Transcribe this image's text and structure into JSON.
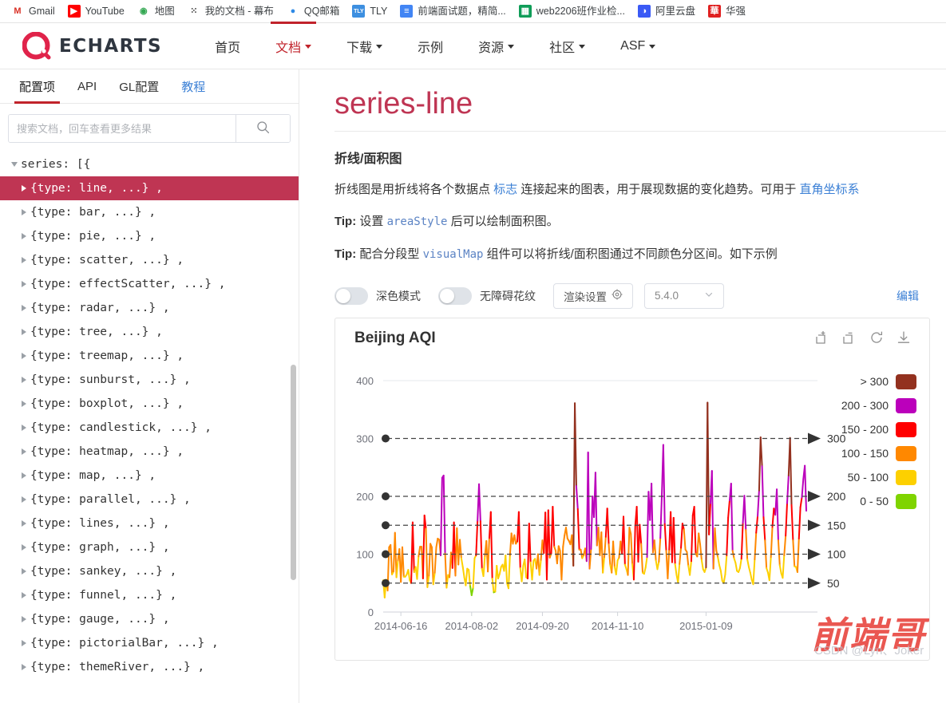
{
  "bookmarks": [
    {
      "label": "Gmail",
      "icon": "gmail-icon",
      "glyph": "M",
      "bg": "#ffffff",
      "fg": "#d93025"
    },
    {
      "label": "YouTube",
      "icon": "youtube-icon",
      "glyph": "▶",
      "bg": "#ff0000",
      "fg": "#ffffff"
    },
    {
      "label": "地图",
      "icon": "google-maps-icon",
      "glyph": "◉",
      "bg": "#ffffff",
      "fg": "#34a853"
    },
    {
      "label": "我的文档 - 幕布",
      "icon": "mubu-icon",
      "glyph": "⁙",
      "bg": "#ffffff",
      "fg": "#2b2b2b"
    },
    {
      "label": "QQ邮箱",
      "icon": "qq-mail-icon",
      "glyph": "●",
      "bg": "#ffffff",
      "fg": "#2e8ae6"
    },
    {
      "label": "TLY",
      "icon": "tly-icon",
      "glyph": "TLY",
      "bg": "#3d8fe0",
      "fg": "#ffffff"
    },
    {
      "label": "前端面试题，精简...",
      "icon": "google-docs-icon",
      "glyph": "≡",
      "bg": "#4285f4",
      "fg": "#ffffff"
    },
    {
      "label": "web2206班作业检...",
      "icon": "google-sheets-icon",
      "glyph": "▦",
      "bg": "#0f9d58",
      "fg": "#ffffff"
    },
    {
      "label": "阿里云盘",
      "icon": "aliyun-drive-icon",
      "glyph": "◑",
      "bg": "#3a5af5",
      "fg": "#ffffff"
    },
    {
      "label": "华强",
      "icon": "huaqiang-icon",
      "glyph": "華",
      "bg": "#e02020",
      "fg": "#ffffff"
    }
  ],
  "header": {
    "brand": "ECHARTS",
    "nav": [
      {
        "label": "首页",
        "caret": false,
        "active": false
      },
      {
        "label": "文档",
        "caret": true,
        "active": true
      },
      {
        "label": "下载",
        "caret": true,
        "active": false
      },
      {
        "label": "示例",
        "caret": false,
        "active": false
      },
      {
        "label": "资源",
        "caret": true,
        "active": false
      },
      {
        "label": "社区",
        "caret": true,
        "active": false
      },
      {
        "label": "ASF",
        "caret": true,
        "active": false
      }
    ]
  },
  "sidebar": {
    "tabs": [
      {
        "label": "配置项",
        "active": true,
        "link": false
      },
      {
        "label": "API",
        "active": false,
        "link": false
      },
      {
        "label": "GL配置",
        "active": false,
        "link": false
      },
      {
        "label": "教程",
        "active": false,
        "link": true
      }
    ],
    "search": {
      "placeholder": "搜索文档，回车查看更多结果",
      "value": "",
      "icon": "search-icon"
    },
    "tree_root": "series: [{",
    "tree_items": [
      {
        "label": "{type: line, ...} ,",
        "selected": true
      },
      {
        "label": "{type: bar, ...} ,",
        "selected": false
      },
      {
        "label": "{type: pie, ...} ,",
        "selected": false
      },
      {
        "label": "{type: scatter, ...} ,",
        "selected": false
      },
      {
        "label": "{type: effectScatter, ...} ,",
        "selected": false
      },
      {
        "label": "{type: radar, ...} ,",
        "selected": false
      },
      {
        "label": "{type: tree, ...} ,",
        "selected": false
      },
      {
        "label": "{type: treemap, ...} ,",
        "selected": false
      },
      {
        "label": "{type: sunburst, ...} ,",
        "selected": false
      },
      {
        "label": "{type: boxplot, ...} ,",
        "selected": false
      },
      {
        "label": "{type: candlestick, ...} ,",
        "selected": false
      },
      {
        "label": "{type: heatmap, ...} ,",
        "selected": false
      },
      {
        "label": "{type: map, ...} ,",
        "selected": false
      },
      {
        "label": "{type: parallel, ...} ,",
        "selected": false
      },
      {
        "label": "{type: lines, ...} ,",
        "selected": false
      },
      {
        "label": "{type: graph, ...} ,",
        "selected": false
      },
      {
        "label": "{type: sankey, ...} ,",
        "selected": false
      },
      {
        "label": "{type: funnel, ...} ,",
        "selected": false
      },
      {
        "label": "{type: gauge, ...} ,",
        "selected": false
      },
      {
        "label": "{type: pictorialBar, ...} ,",
        "selected": false
      },
      {
        "label": "{type: themeRiver, ...} ,",
        "selected": false
      }
    ]
  },
  "main": {
    "title": "series-line",
    "subheading": "折线/面积图",
    "para1_a": "折线图是用折线将各个数据点 ",
    "para1_link1": "标志",
    "para1_b": " 连接起来的图表，用于展现数据的变化趋势。可用于 ",
    "para1_link2": "直角坐标系",
    "tip_label": "Tip:",
    "tip1_a": " 设置 ",
    "tip1_code": "areaStyle",
    "tip1_b": " 后可以绘制面积图。",
    "tip2_a": " 配合分段型 ",
    "tip2_code": "visualMap",
    "tip2_b": " 组件可以将折线/面积图通过不同颜色分区间。如下示例"
  },
  "demo_toolbar": {
    "dark_mode_label": "深色模式",
    "dark_mode_on": false,
    "accessible_label": "无障碍花纹",
    "accessible_on": false,
    "render_settings_label": "渲染设置",
    "render_settings_icon": "gear-icon",
    "version_value": "5.4.0",
    "version_icon": "chevron-down-icon",
    "edit_label": "编辑"
  },
  "chart_toolbox": [
    {
      "name": "data-zoom-icon",
      "title": "区域缩放"
    },
    {
      "name": "data-zoom-reset-icon",
      "title": "区域缩放还原"
    },
    {
      "name": "restore-icon",
      "title": "还原"
    },
    {
      "name": "save-image-icon",
      "title": "保存为图片"
    }
  ],
  "watermark": {
    "cn": "前端哥",
    "en": "CSDN @Lyn、Joker"
  },
  "chart_data": {
    "type": "line",
    "title": "Beijing AQI",
    "xlabel": "",
    "ylabel": "",
    "ylim": [
      0,
      400
    ],
    "yticks": [
      0,
      100,
      200,
      300,
      400
    ],
    "xtick_labels": [
      "2014-06-16",
      "2014-08-02",
      "2014-09-20",
      "2014-11-10",
      "2015-01-09"
    ],
    "grid": false,
    "legend_position": "right",
    "visual_map": {
      "type": "piecewise",
      "pieces": [
        {
          "label": "> 300",
          "color": "#93311f",
          "min": 300
        },
        {
          "label": "200 - 300",
          "color": "#bb00bb",
          "min": 200,
          "max": 300
        },
        {
          "label": "150 - 200",
          "color": "#ff0000",
          "min": 150,
          "max": 200
        },
        {
          "label": "100 - 150",
          "color": "#ff8800",
          "min": 100,
          "max": 150
        },
        {
          "label": "50 - 100",
          "color": "#fdd000",
          "min": 50,
          "max": 100
        },
        {
          "label": "0 - 50",
          "color": "#7fd400",
          "min": 0,
          "max": 50
        }
      ]
    },
    "mark_lines": [
      {
        "label": "300",
        "value": 300
      },
      {
        "label": "200",
        "value": 200
      },
      {
        "label": "150",
        "value": 150
      },
      {
        "label": "100",
        "value": 100
      },
      {
        "label": "50",
        "value": 50
      }
    ],
    "series": [
      {
        "name": "Beijing AQI",
        "values": [
          55,
          25,
          56,
          37,
          112,
          116,
          65,
          70,
          137,
          60,
          89,
          109,
          52,
          112,
          61,
          61,
          65,
          73,
          55,
          50,
          155,
          69,
          78,
          57,
          96,
          113,
          113,
          58,
          167,
          144,
          43,
          63,
          118,
          112,
          48,
          68,
          112,
          127,
          125,
          98,
          232,
          236,
          101,
          42,
          64,
          60,
          103,
          76,
          155,
          63,
          145,
          82,
          125,
          93,
          78,
          60,
          46,
          75,
          73,
          45,
          29,
          42,
          93,
          98,
          158,
          221,
          157,
          75,
          62,
          97,
          123,
          70,
          128,
          173,
          58,
          34,
          35,
          80,
          58,
          66,
          78,
          82,
          71,
          98,
          50,
          41,
          98,
          136,
          118,
          133,
          118,
          122,
          173,
          76,
          53,
          80,
          91,
          60,
          58,
          153,
          86,
          56,
          89,
          92,
          75,
          100,
          64,
          90,
          124,
          102,
          172,
          56,
          176,
          94,
          101,
          182,
          113,
          106,
          84,
          114,
          106,
          56,
          113,
          132,
          146,
          127,
          123,
          117,
          133,
          80,
          361,
          218,
          178,
          108,
          108,
          93,
          98,
          110,
          88,
          276,
          75,
          109,
          200,
          164,
          241,
          115,
          146,
          98,
          138,
          68,
          95,
          130,
          179,
          117,
          81,
          68,
          122,
          78,
          65,
          89,
          94,
          122,
          101,
          165,
          82,
          74,
          64,
          146,
          135,
          83,
          56,
          150,
          182,
          87,
          151,
          118,
          68,
          66,
          77,
          95,
          208,
          159,
          222,
          103,
          124,
          89,
          74,
          87,
          128,
          201,
          289,
          152,
          106,
          58,
          108,
          173,
          86,
          163,
          83,
          64,
          51,
          83,
          111,
          153,
          143,
          108,
          104,
          80,
          64,
          88,
          167,
          182,
          101,
          96,
          136,
          117,
          90,
          74,
          69,
          77,
          362,
          134,
          188,
          244,
          75,
          145,
          106,
          95,
          81,
          71,
          54,
          50,
          65,
          98,
          163,
          193,
          222,
          106,
          93,
          85,
          71,
          69,
          76,
          92,
          154,
          201,
          142,
          91,
          78,
          68,
          56,
          48,
          91,
          137,
          166,
          210,
          302,
          252,
          164,
          124,
          76,
          68,
          55,
          95,
          147,
          179,
          168,
          212,
          124,
          81,
          67,
          59,
          98,
          132,
          188,
          236,
          301,
          185,
          124,
          79,
          78,
          69,
          127,
          181,
          198,
          230,
          253,
          175
        ]
      }
    ]
  }
}
